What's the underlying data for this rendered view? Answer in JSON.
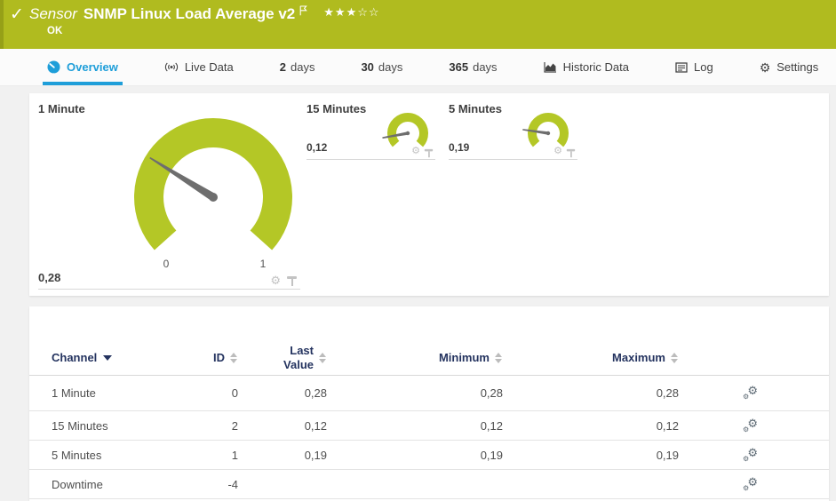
{
  "topbar": {
    "check_icon": "✓",
    "kind_label": "Sensor",
    "sensor_name": "SNMP Linux Load Average v2",
    "status": "OK",
    "stars": {
      "filled": 3,
      "empty": 2
    }
  },
  "tabs": {
    "overview": "Overview",
    "live_data": "Live Data",
    "days2_num": "2",
    "days2_label": "days",
    "days30_num": "30",
    "days30_label": "days",
    "days365_num": "365",
    "days365_label": "days",
    "historic": "Historic Data",
    "log": "Log",
    "settings": "Settings"
  },
  "gauges": [
    {
      "title": "1 Minute",
      "value_display": "0,28",
      "value": 0.28,
      "min": 0,
      "max": 1,
      "min_label": "0",
      "max_label": "1"
    },
    {
      "title": "15 Minutes",
      "value_display": "0,12",
      "value": 0.12,
      "min": 0,
      "max": 1
    },
    {
      "title": "5 Minutes",
      "value_display": "0,19",
      "value": 0.19,
      "min": 0,
      "max": 1
    }
  ],
  "table": {
    "headers": {
      "channel": "Channel",
      "id": "ID",
      "last_value": "Last Value",
      "minimum": "Minimum",
      "maximum": "Maximum"
    },
    "rows": [
      {
        "channel": "1 Minute",
        "id": "0",
        "last": "0,28",
        "min": "0,28",
        "max": "0,28"
      },
      {
        "channel": "15 Minutes",
        "id": "2",
        "last": "0,12",
        "min": "0,12",
        "max": "0,12"
      },
      {
        "channel": "5 Minutes",
        "id": "1",
        "last": "0,19",
        "min": "0,19",
        "max": "0,19"
      },
      {
        "channel": "Downtime",
        "id": "-4",
        "last": "",
        "min": "",
        "max": ""
      }
    ]
  },
  "colors": {
    "brand_green": "#b0bb1f",
    "gauge_green": "#b4c726",
    "accent_blue": "#1e9ed9",
    "header_navy": "#24335f"
  }
}
